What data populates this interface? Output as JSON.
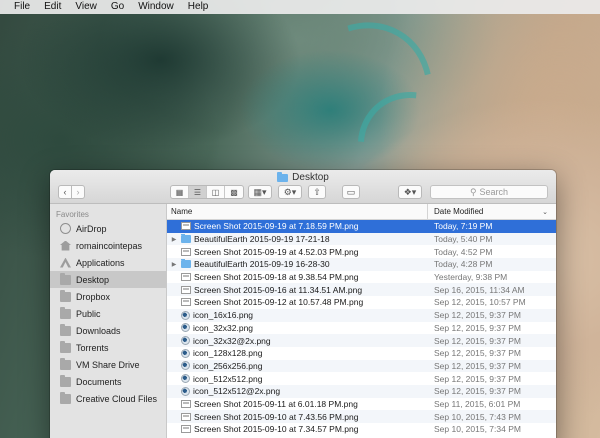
{
  "menubar": {
    "items": [
      "File",
      "Edit",
      "View",
      "Go",
      "Window",
      "Help"
    ]
  },
  "window": {
    "title": "Desktop",
    "toolbar": {
      "search_placeholder": "Search"
    }
  },
  "sidebar": {
    "header": "Favorites",
    "items": [
      {
        "label": "AirDrop",
        "icon": "airdrop-icon"
      },
      {
        "label": "romaincointepas",
        "icon": "home-icon"
      },
      {
        "label": "Applications",
        "icon": "applications-icon"
      },
      {
        "label": "Desktop",
        "icon": "folder-icon",
        "selected": true
      },
      {
        "label": "Dropbox",
        "icon": "folder-icon"
      },
      {
        "label": "Public",
        "icon": "folder-icon"
      },
      {
        "label": "Downloads",
        "icon": "folder-icon"
      },
      {
        "label": "Torrents",
        "icon": "folder-icon"
      },
      {
        "label": "VM Share Drive",
        "icon": "folder-icon"
      },
      {
        "label": "Documents",
        "icon": "folder-icon"
      },
      {
        "label": "Creative Cloud Files",
        "icon": "folder-icon"
      }
    ]
  },
  "file_list": {
    "columns": {
      "name": "Name",
      "date": "Date Modified"
    },
    "rows": [
      {
        "name": "Screen Shot 2015-09-19 at 7.18.59 PM.png",
        "date": "Today, 7:19 PM",
        "type": "png",
        "selected": true
      },
      {
        "name": "BeautifulEarth 2015-09-19 17-21-18",
        "date": "Today, 5:40 PM",
        "type": "folder"
      },
      {
        "name": "Screen Shot 2015-09-19 at 4.52.03 PM.png",
        "date": "Today, 4:52 PM",
        "type": "png"
      },
      {
        "name": "BeautifulEarth 2015-09-19 16-28-30",
        "date": "Today, 4:28 PM",
        "type": "folder"
      },
      {
        "name": "Screen Shot 2015-09-18 at 9.38.54 PM.png",
        "date": "Yesterday, 9:38 PM",
        "type": "png"
      },
      {
        "name": "Screen Shot 2015-09-16 at 11.34.51 AM.png",
        "date": "Sep 16, 2015, 11:34 AM",
        "type": "png"
      },
      {
        "name": "Screen Shot 2015-09-12 at 10.57.48 PM.png",
        "date": "Sep 12, 2015, 10:57 PM",
        "type": "png"
      },
      {
        "name": "icon_16x16.png",
        "date": "Sep 12, 2015, 9:37 PM",
        "type": "icon"
      },
      {
        "name": "icon_32x32.png",
        "date": "Sep 12, 2015, 9:37 PM",
        "type": "icon"
      },
      {
        "name": "icon_32x32@2x.png",
        "date": "Sep 12, 2015, 9:37 PM",
        "type": "icon"
      },
      {
        "name": "icon_128x128.png",
        "date": "Sep 12, 2015, 9:37 PM",
        "type": "icon"
      },
      {
        "name": "icon_256x256.png",
        "date": "Sep 12, 2015, 9:37 PM",
        "type": "icon"
      },
      {
        "name": "icon_512x512.png",
        "date": "Sep 12, 2015, 9:37 PM",
        "type": "icon"
      },
      {
        "name": "icon_512x512@2x.png",
        "date": "Sep 12, 2015, 9:37 PM",
        "type": "icon"
      },
      {
        "name": "Screen Shot 2015-09-11 at 6.01.18 PM.png",
        "date": "Sep 11, 2015, 6:01 PM",
        "type": "png"
      },
      {
        "name": "Screen Shot 2015-09-10 at 7.43.56 PM.png",
        "date": "Sep 10, 2015, 7:43 PM",
        "type": "png"
      },
      {
        "name": "Screen Shot 2015-09-10 at 7.34.57 PM.png",
        "date": "Sep 10, 2015, 7:34 PM",
        "type": "png"
      }
    ]
  }
}
